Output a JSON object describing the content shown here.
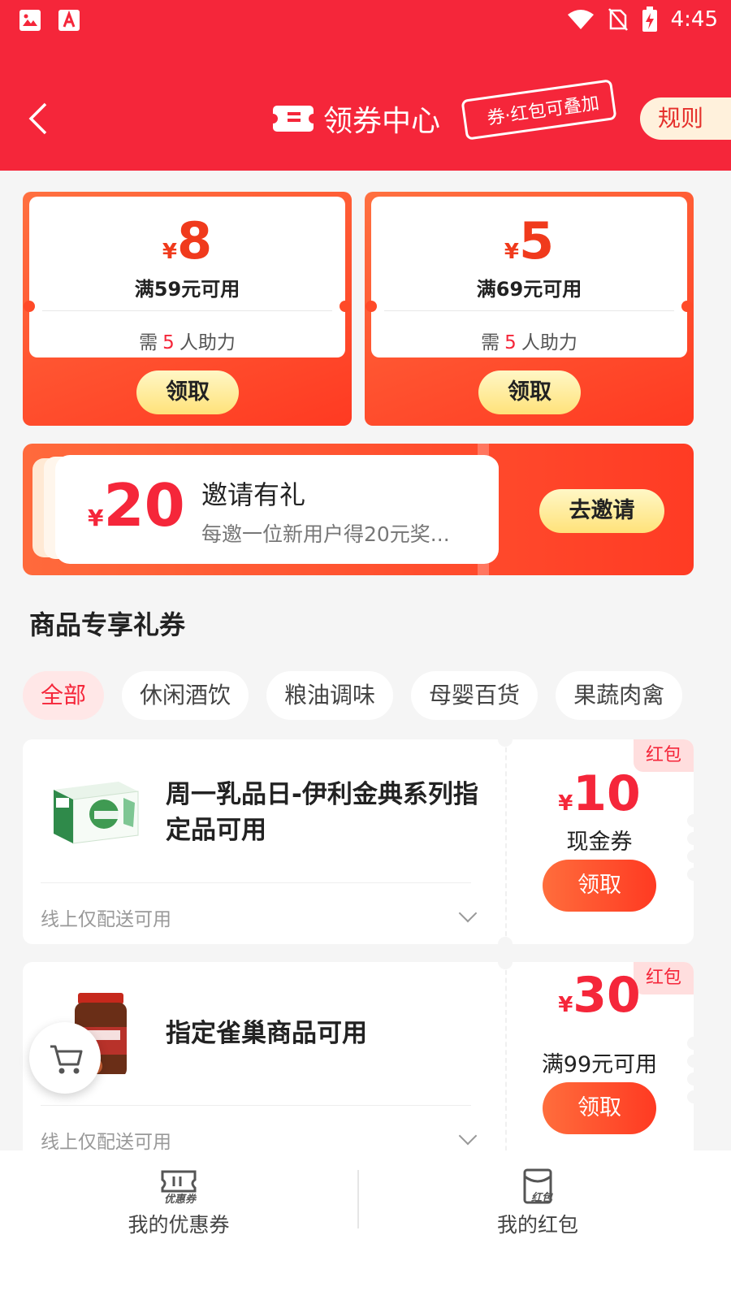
{
  "status_bar": {
    "time": "4:45"
  },
  "header": {
    "title": "领券中心",
    "stack_tag": "券·红包可叠加",
    "rules_label": "规则"
  },
  "top_coupons": [
    {
      "currency": "¥",
      "amount": "8",
      "condition": "满59元可用",
      "need_prefix": "需",
      "need_count": "5",
      "need_suffix": "人助力",
      "button": "领取"
    },
    {
      "currency": "¥",
      "amount": "5",
      "condition": "满69元可用",
      "need_prefix": "需",
      "need_count": "5",
      "need_suffix": "人助力",
      "button": "领取"
    }
  ],
  "invite": {
    "currency": "¥",
    "amount": "20",
    "title": "邀请有礼",
    "subtitle": "每邀一位新用户得20元奖...",
    "button": "去邀请"
  },
  "section": {
    "title": "商品专享礼券"
  },
  "tabs": [
    {
      "label": "全部",
      "active": true
    },
    {
      "label": "休闲酒饮"
    },
    {
      "label": "粮油调味"
    },
    {
      "label": "母婴百货"
    },
    {
      "label": "果蔬肉禽"
    }
  ],
  "product_coupons": [
    {
      "tag": "红包",
      "title": "周一乳品日-伊利金典系列指定品可用",
      "currency": "¥",
      "amount": "10",
      "kind": "现金券",
      "button": "领取",
      "note": "线上仅配送可用"
    },
    {
      "tag": "红包",
      "title": "指定雀巢商品可用",
      "currency": "¥",
      "amount": "30",
      "kind": "满99元可用",
      "button": "领取",
      "note": "线上仅配送可用"
    }
  ],
  "bottom_nav": [
    {
      "icon_text": "优惠券",
      "label": "我的优惠券"
    },
    {
      "icon_text": "红包",
      "label": "我的红包"
    }
  ],
  "colors": {
    "brand_red": "#f5263a",
    "accent_orange": "#ff3a22",
    "claim_yellow": "#ffe27a",
    "tag_pink": "#ffdede"
  },
  "icons": [
    "image-icon",
    "app-a-icon",
    "wifi-icon",
    "no-sim-icon",
    "battery-charging-icon",
    "back-chevron-icon",
    "ticket-icon",
    "cart-icon",
    "coupon-icon",
    "red-packet-icon",
    "chevron-down-icon"
  ]
}
